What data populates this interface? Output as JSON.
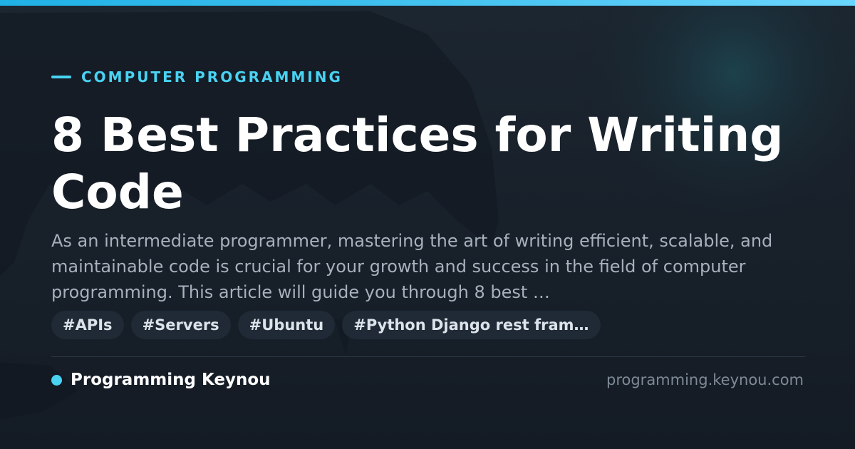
{
  "card": {
    "category": "COMPUTER PROGRAMMING",
    "title": "8 Best Practices for Writing Code",
    "description": "As an intermediate programmer, mastering the art of writing efficient, scalable, and maintainable code is crucial for your growth and success in the field of computer programming. This article will guide you through 8 best …",
    "tags": [
      "#APIs",
      "#Servers",
      "#Ubuntu",
      "#Python Django rest fram…"
    ],
    "site_name": "Programming Keynou",
    "domain": "programming.keynou.com"
  },
  "colors": {
    "accent": "#49d2f2",
    "background": "#161d27",
    "tag_background": "#1f2a36",
    "title": "#ffffff",
    "description": "#a7b1bd",
    "domain": "#7e8a97"
  }
}
